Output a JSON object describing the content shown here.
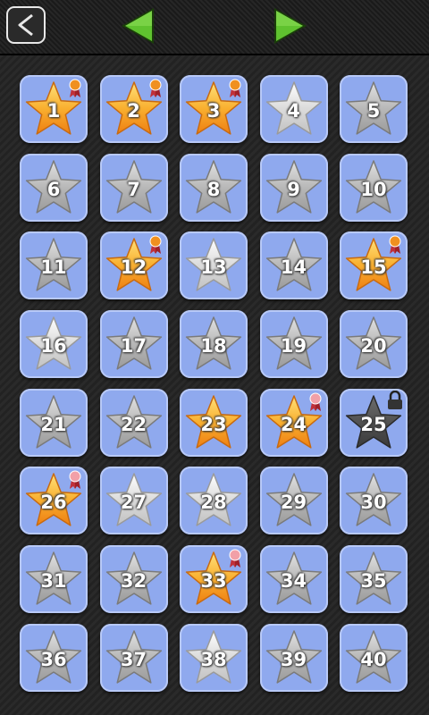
{
  "header": {
    "back_icon": "back-chevron-icon",
    "prev_icon": "triangle-left-icon",
    "next_icon": "triangle-right-icon",
    "arrow_color": "#5fc22f"
  },
  "colors": {
    "tile": "#8fa9ee",
    "star_gold": "#f59a1e",
    "star_silver": "#c8c8c8",
    "star_locked": "#4a4a4a",
    "medal_orange": "#f09020",
    "medal_pink": "#f2a0a8"
  },
  "levels": [
    {
      "label": "1",
      "state": "gold",
      "badge": "medal-orange"
    },
    {
      "label": "2",
      "state": "gold",
      "badge": "medal-orange"
    },
    {
      "label": "3",
      "state": "gold",
      "badge": "medal-orange"
    },
    {
      "label": "4",
      "state": "silver-light",
      "badge": ""
    },
    {
      "label": "5",
      "state": "silver",
      "badge": ""
    },
    {
      "label": "6",
      "state": "silver",
      "badge": ""
    },
    {
      "label": "7",
      "state": "silver",
      "badge": ""
    },
    {
      "label": "8",
      "state": "silver",
      "badge": ""
    },
    {
      "label": "9",
      "state": "silver",
      "badge": ""
    },
    {
      "label": "10",
      "state": "silver",
      "badge": ""
    },
    {
      "label": "11",
      "state": "silver",
      "badge": ""
    },
    {
      "label": "12",
      "state": "gold",
      "badge": "medal-orange"
    },
    {
      "label": "13",
      "state": "silver-light",
      "badge": ""
    },
    {
      "label": "14",
      "state": "silver",
      "badge": ""
    },
    {
      "label": "15",
      "state": "gold",
      "badge": "medal-orange"
    },
    {
      "label": "16",
      "state": "silver-light",
      "badge": ""
    },
    {
      "label": "17",
      "state": "silver",
      "badge": ""
    },
    {
      "label": "18",
      "state": "silver",
      "badge": ""
    },
    {
      "label": "19",
      "state": "silver",
      "badge": ""
    },
    {
      "label": "20",
      "state": "silver",
      "badge": ""
    },
    {
      "label": "21",
      "state": "silver",
      "badge": ""
    },
    {
      "label": "22",
      "state": "silver",
      "badge": ""
    },
    {
      "label": "23",
      "state": "gold",
      "badge": ""
    },
    {
      "label": "24",
      "state": "gold",
      "badge": "medal-pink"
    },
    {
      "label": "25",
      "state": "locked",
      "badge": "lock"
    },
    {
      "label": "26",
      "state": "gold",
      "badge": "medal-pink"
    },
    {
      "label": "27",
      "state": "silver-light",
      "badge": ""
    },
    {
      "label": "28",
      "state": "silver-light",
      "badge": ""
    },
    {
      "label": "29",
      "state": "silver",
      "badge": ""
    },
    {
      "label": "30",
      "state": "silver",
      "badge": ""
    },
    {
      "label": "31",
      "state": "silver",
      "badge": ""
    },
    {
      "label": "32",
      "state": "silver",
      "badge": ""
    },
    {
      "label": "33",
      "state": "gold",
      "badge": "medal-pink"
    },
    {
      "label": "34",
      "state": "silver",
      "badge": ""
    },
    {
      "label": "35",
      "state": "silver",
      "badge": ""
    },
    {
      "label": "36",
      "state": "silver",
      "badge": ""
    },
    {
      "label": "37",
      "state": "silver",
      "badge": ""
    },
    {
      "label": "38",
      "state": "silver-light",
      "badge": ""
    },
    {
      "label": "39",
      "state": "silver",
      "badge": ""
    },
    {
      "label": "40",
      "state": "silver",
      "badge": ""
    }
  ]
}
